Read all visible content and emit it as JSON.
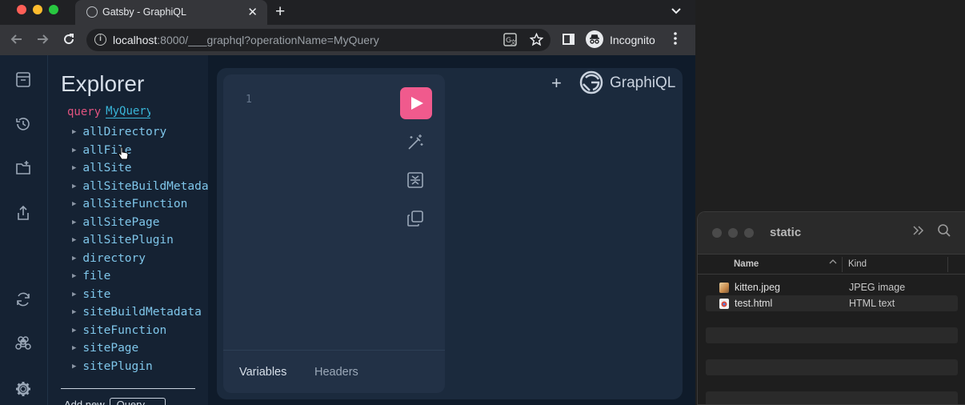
{
  "browser": {
    "tab_title": "Gatsby - GraphiQL",
    "tab_close": "✕",
    "new_tab": "+",
    "tab_menu": "⌄",
    "url_host": "localhost",
    "url_rest": ":8000/___graphql?operationName=MyQuery",
    "profile_label": "Incognito"
  },
  "explorer": {
    "title": "Explorer",
    "query_keyword": "query",
    "query_name": "MyQuery",
    "fields": [
      "allDirectory",
      "allFile",
      "allSite",
      "allSiteBuildMetadata",
      "allSiteFunction",
      "allSitePage",
      "allSitePlugin",
      "directory",
      "file",
      "site",
      "siteBuildMetadata",
      "siteFunction",
      "sitePage",
      "sitePlugin"
    ],
    "add_new_label": "Add new",
    "add_new_select": "Query"
  },
  "editor": {
    "line_number": "1",
    "footer_tabs": [
      "Variables",
      "Headers"
    ]
  },
  "graphiql": {
    "plus": "+",
    "title": "GraphiQL"
  },
  "finder": {
    "title": "static",
    "col_name": "Name",
    "col_kind": "Kind",
    "files": [
      {
        "name": "kitten.jpeg",
        "kind": "JPEG image",
        "icon": "jpeg-file-icon"
      },
      {
        "name": "test.html",
        "kind": "HTML text",
        "icon": "html-file-icon"
      }
    ]
  },
  "colors": {
    "run_button": "#f05a8d",
    "field": "#7fc6ea",
    "keyword": "#e0537f",
    "query_name": "#39b5d8"
  }
}
